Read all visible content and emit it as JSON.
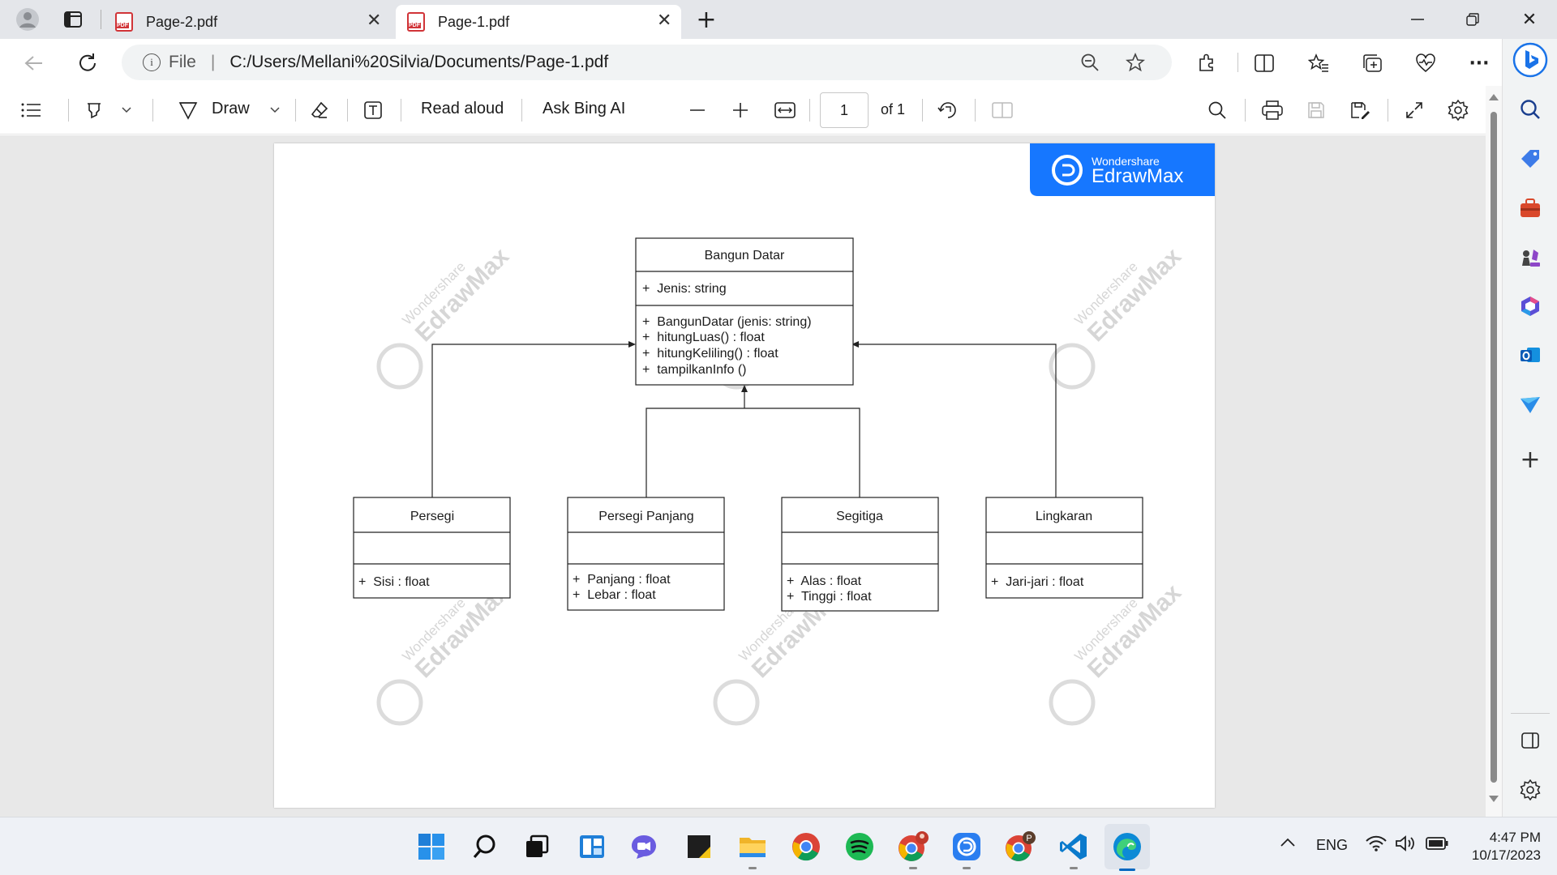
{
  "tabs": [
    {
      "label": "Page-2.pdf",
      "active": false
    },
    {
      "label": "Page-1.pdf",
      "active": true
    }
  ],
  "address": {
    "scheme": "File",
    "url": "C:/Users/Mellani%20Silvia/Documents/Page-1.pdf"
  },
  "pdf_toolbar": {
    "draw_label": "Draw",
    "read_aloud_label": "Read aloud",
    "ask_bing_label": "Ask Bing AI",
    "page_number": "1",
    "page_total": "of 1"
  },
  "document": {
    "brand_small": "Wondershare",
    "brand_large": "EdrawMax",
    "watermark_small": "Wondershare",
    "watermark_large": "EdrawMax",
    "classes": {
      "bangun_datar": {
        "name": "Bangun Datar",
        "attributes": [
          "+  Jenis: string"
        ],
        "methods": [
          "+  BangunDatar (jenis: string)",
          "+  hitungLuas() : float",
          "+  hitungKeliling() : float",
          "+  tampilkanInfo ()"
        ]
      },
      "persegi": {
        "name": "Persegi",
        "attributes": [],
        "methods": [
          "+  Sisi : float"
        ]
      },
      "persegi_panjang": {
        "name": "Persegi Panjang",
        "attributes": [],
        "methods": [
          "+  Panjang : float",
          "+  Lebar : float"
        ]
      },
      "segitiga": {
        "name": "Segitiga",
        "attributes": [],
        "methods": [
          "+  Alas : float",
          "+  Tinggi : float"
        ]
      },
      "lingkaran": {
        "name": "Lingkaran",
        "attributes": [],
        "methods": [
          "+  Jari-jari : float"
        ]
      }
    }
  },
  "system_tray": {
    "language": "ENG",
    "time": "4:47 PM",
    "date": "10/17/2023"
  },
  "colors": {
    "edraw_blue": "#1677ff",
    "tab_strip": "#e4e6ea",
    "viewer_bg": "#e8e8e8"
  }
}
